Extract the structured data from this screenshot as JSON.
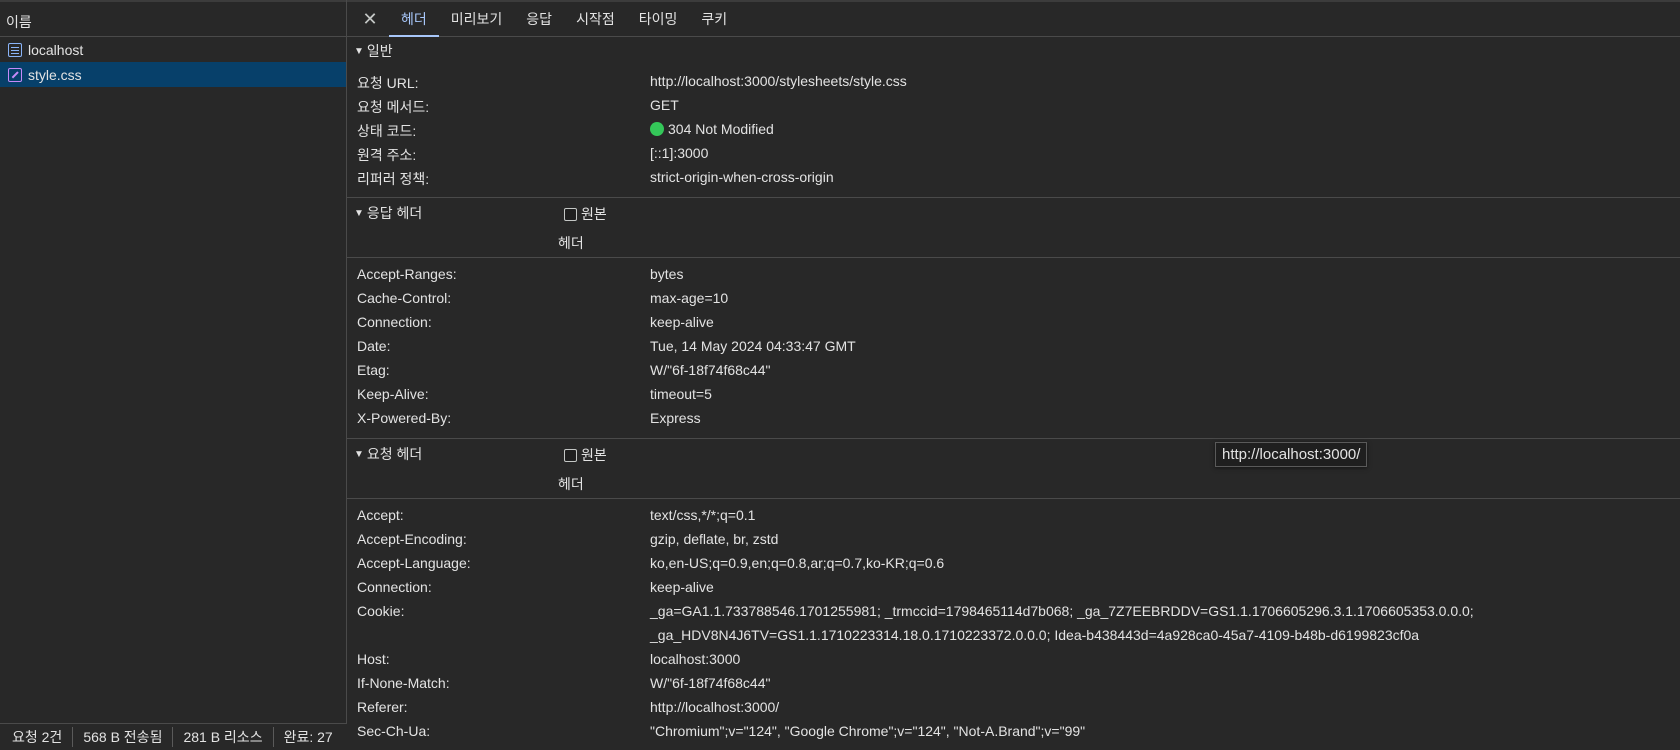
{
  "left": {
    "header": "이름",
    "requests": [
      {
        "name": "localhost",
        "icon": "document-icon",
        "selected": false
      },
      {
        "name": "style.css",
        "icon": "stylesheet-icon",
        "selected": true
      }
    ],
    "status": [
      "요청 2건",
      "568 B 전송됨",
      "281 B 리소스",
      "완료: 27"
    ]
  },
  "tabs": [
    "헤더",
    "미리보기",
    "응답",
    "시작점",
    "타이밍",
    "쿠키"
  ],
  "general": {
    "title": "일반",
    "rows": [
      {
        "k": "요청 URL:",
        "v": "http://localhost:3000/stylesheets/style.css"
      },
      {
        "k": "요청 메서드:",
        "v": "GET"
      },
      {
        "k": "상태 코드:",
        "v": "304 Not Modified"
      },
      {
        "k": "원격 주소:",
        "v": "[::1]:3000"
      },
      {
        "k": "리퍼러 정책:",
        "v": "strict-origin-when-cross-origin"
      }
    ]
  },
  "response_headers": {
    "title": "응답 헤더",
    "raw_label": "원본",
    "sub_label": "헤더",
    "rows": [
      {
        "k": "Accept-Ranges:",
        "v": "bytes"
      },
      {
        "k": "Cache-Control:",
        "v": "max-age=10"
      },
      {
        "k": "Connection:",
        "v": "keep-alive"
      },
      {
        "k": "Date:",
        "v": "Tue, 14 May 2024 04:33:47 GMT"
      },
      {
        "k": "Etag:",
        "v": "W/\"6f-18f74f68c44\""
      },
      {
        "k": "Keep-Alive:",
        "v": "timeout=5"
      },
      {
        "k": "X-Powered-By:",
        "v": "Express"
      }
    ]
  },
  "request_headers": {
    "title": "요청 헤더",
    "raw_label": "원본",
    "sub_label": "헤더",
    "rows": [
      {
        "k": "Accept:",
        "v": "text/css,*/*;q=0.1"
      },
      {
        "k": "Accept-Encoding:",
        "v": "gzip, deflate, br, zstd"
      },
      {
        "k": "Accept-Language:",
        "v": "ko,en-US;q=0.9,en;q=0.8,ar;q=0.7,ko-KR;q=0.6"
      },
      {
        "k": "Connection:",
        "v": "keep-alive"
      },
      {
        "k": "Cookie:",
        "v": "_ga=GA1.1.733788546.1701255981; _trmccid=1798465114d7b068; _ga_7Z7EEBRDDV=GS1.1.1706605296.3.1.1706605353.0.0.0; _ga_HDV8N4J6TV=GS1.1.1710223314.18.0.1710223372.0.0.0; Idea-b438443d=4a928ca0-45a7-4109-b48b-d6199823cf0a"
      },
      {
        "k": "Host:",
        "v": "localhost:3000"
      },
      {
        "k": "If-None-Match:",
        "v": "W/\"6f-18f74f68c44\""
      },
      {
        "k": "Referer:",
        "v": "http://localhost:3000/"
      },
      {
        "k": "Sec-Ch-Ua:",
        "v": "\"Chromium\";v=\"124\", \"Google Chrome\";v=\"124\", \"Not-A.Brand\";v=\"99\""
      }
    ]
  },
  "tooltip": "http://localhost:3000/",
  "colors": {
    "status_ok": "#34c759",
    "selected_row": "#07406a",
    "active_tab": "#a8c7fa"
  }
}
